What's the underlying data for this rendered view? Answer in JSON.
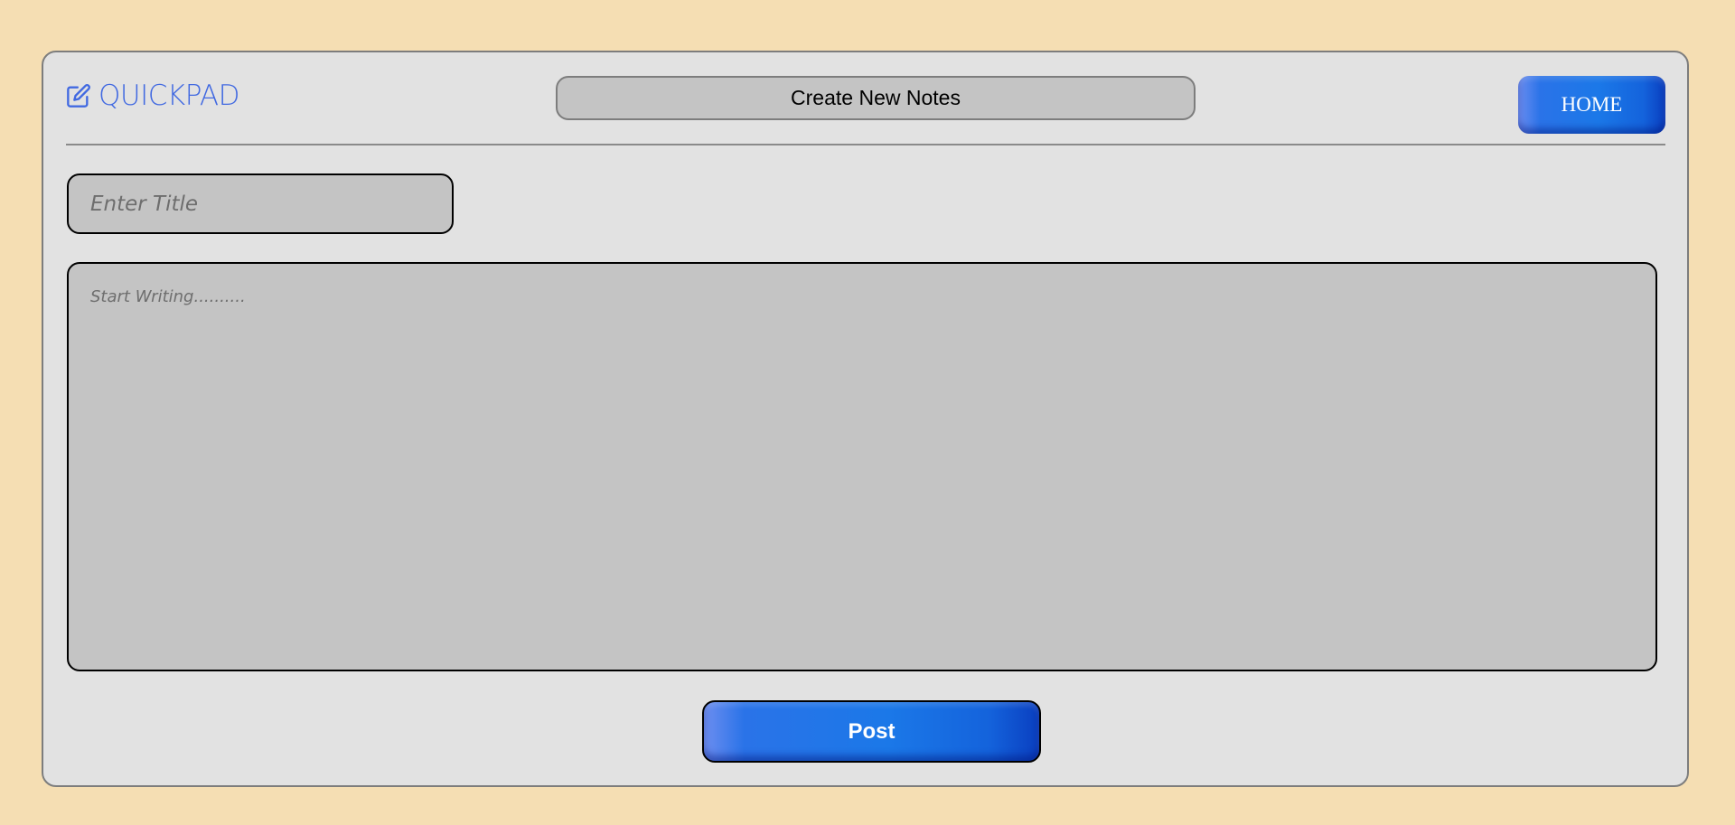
{
  "brand": {
    "name": "QUICKPAD",
    "icon": "edit-icon",
    "color": "#4169e1"
  },
  "header": {
    "title": "Create New Notes"
  },
  "nav": {
    "home_label": "HOME"
  },
  "form": {
    "title_placeholder": "Enter Title",
    "title_value": "",
    "body_placeholder": "Start Writing..........",
    "body_value": "",
    "post_label": "Post"
  },
  "colors": {
    "background": "#f5deb3",
    "card": "#e2e2e2",
    "field": "#c4c4c4",
    "accent": "#1b78e8"
  }
}
